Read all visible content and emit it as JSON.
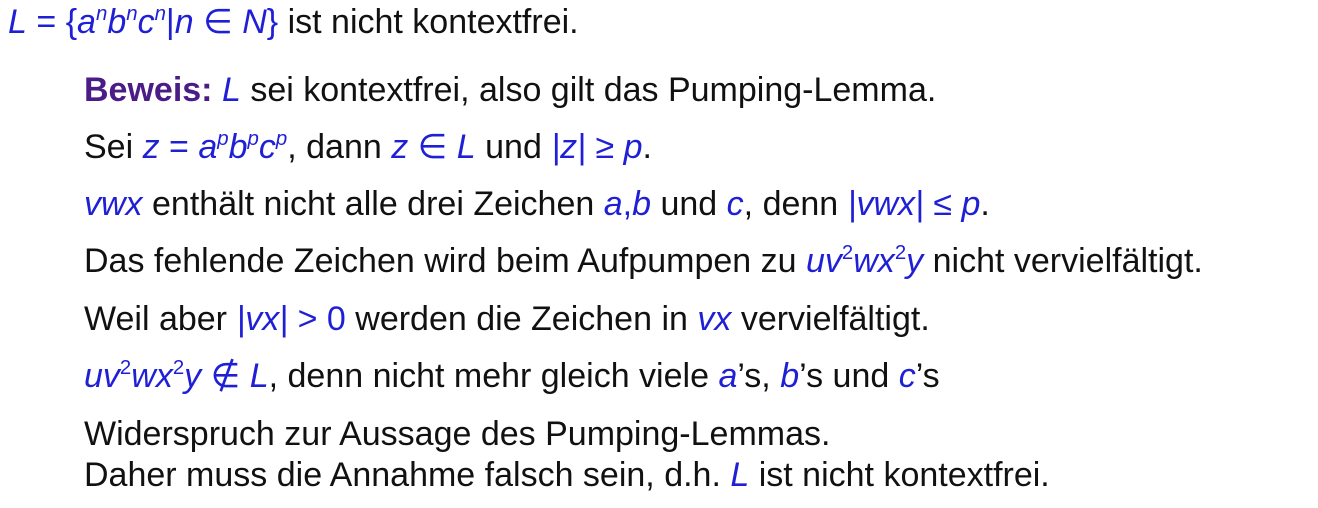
{
  "theorem": {
    "lang": "L",
    "eq": "=",
    "set_open": "{",
    "a": "a",
    "b": "b",
    "c": "c",
    "n": "n",
    "bar": "|",
    "in": "∈",
    "N": "N",
    "set_close": "}",
    "text": "ist nicht kontextfrei."
  },
  "proof": {
    "label": "Beweis:",
    "l1_var": "L",
    "l1_text": "sei kontextfrei, also gilt das Pumping-Lemma.",
    "l2_sei": "Sei",
    "z": "z",
    "eq": "=",
    "p": "p",
    "l2_dann": ", dann",
    "in": "∈",
    "L": "L",
    "und": "und",
    "abs_z": "|z|",
    "geq": "≥",
    "dot": ".",
    "vwx": "vwx",
    "l3_text": "enthält nicht alle drei Zeichen",
    "a": "a",
    "comma": ",",
    "b": "b",
    "c": "c",
    "l3_denn": ", denn",
    "abs_vwx": "|vwx|",
    "leq": "≤",
    "l4_text": "Das fehlende Zeichen wird beim Aufpumpen zu",
    "uv": "uv",
    "two": "2",
    "wx": "wx",
    "y": "y",
    "l4_end": "nicht vervielfältigt.",
    "l5_text": "Weil aber",
    "abs_vx": "|vx|",
    "gt": ">",
    "zero": "0",
    "l5_mid": "werden die Zeichen in",
    "vx": "vx",
    "l5_end": "vervielfältigt.",
    "notin": "∉",
    "l6_mid": ", denn nicht mehr gleich viele",
    "s": "’s,",
    "s_end": "’s",
    "l7": "Widerspruch zur Aussage des Pumping-Lemmas.",
    "l8_text": "Daher muss die Annahme falsch sein, d.h.",
    "l8_end": "ist nicht kontextfrei."
  }
}
